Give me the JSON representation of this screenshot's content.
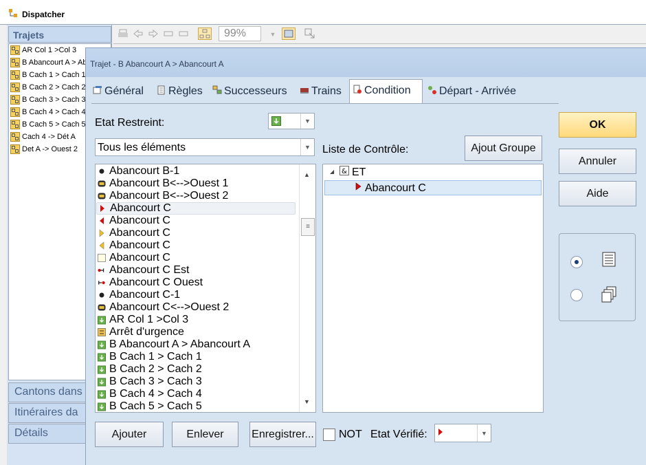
{
  "app": {
    "title": "Dispatcher"
  },
  "left_panel": {
    "header": "Trajets",
    "items": [
      "AR Col 1 >Col 3",
      "B Abancourt A > Abancourt A",
      "B Cach 1 > Cach 1",
      "B Cach 2 > Cach 2",
      "B Cach 3 > Cach 3",
      "B Cach 4 > Cach 4",
      "B Cach 5 > Cach 5",
      "Cach 4 -> Dét A",
      "Det A -> Ouest 2"
    ],
    "nav": [
      "Cantons dans",
      "Itinéraires da",
      "Détails"
    ]
  },
  "toolbar": {
    "zoom": "99%"
  },
  "dialog": {
    "title": "Trajet - B Abancourt A > Abancourt A",
    "tabs": [
      "Général",
      "Règles",
      "Successeurs",
      "Trains",
      "Condition",
      "Départ - Arrivée"
    ],
    "selected_tab": "Condition",
    "etat_restreint_label": "Etat Restreint:",
    "filter_value": "Tous les éléments",
    "liste_label": "Liste de Contrôle:",
    "ajout_groupe": "Ajout Groupe",
    "elements": [
      {
        "text": "Abancourt B-1",
        "icon": "dot"
      },
      {
        "text": "Abancourt B<-->Ouest 1",
        "icon": "loco"
      },
      {
        "text": "Abancourt B<-->Ouest 2",
        "icon": "loco"
      },
      {
        "text": "Abancourt C",
        "icon": "tri-right-red"
      },
      {
        "text": "Abancourt C",
        "icon": "tri-left-red"
      },
      {
        "text": "Abancourt C",
        "icon": "tri-right-yellow"
      },
      {
        "text": "Abancourt C",
        "icon": "tri-left-yellow"
      },
      {
        "text": "Abancourt C",
        "icon": "empty-box"
      },
      {
        "text": "Abancourt C Est",
        "icon": "signal-left"
      },
      {
        "text": "Abancourt C Ouest",
        "icon": "signal-right"
      },
      {
        "text": "Abancourt C-1",
        "icon": "dot"
      },
      {
        "text": "Abancourt C<-->Ouest 2",
        "icon": "loco"
      },
      {
        "text": "AR Col 1 >Col 3",
        "icon": "green-arrow"
      },
      {
        "text": "Arrêt d'urgence",
        "icon": "emergency"
      },
      {
        "text": "B Abancourt A > Abancourt A",
        "icon": "green-arrow"
      },
      {
        "text": "B Cach 1 > Cach 1",
        "icon": "green-arrow"
      },
      {
        "text": "B Cach 2 > Cach 2",
        "icon": "green-arrow"
      },
      {
        "text": "B Cach 3 > Cach 3",
        "icon": "green-arrow"
      },
      {
        "text": "B Cach 4 > Cach 4",
        "icon": "green-arrow"
      },
      {
        "text": "B Cach 5 > Cach 5",
        "icon": "green-arrow"
      }
    ],
    "control_tree": {
      "root": "ET",
      "child": "Abancourt C"
    },
    "buttons": {
      "ok": "OK",
      "cancel": "Annuler",
      "help": "Aide",
      "add": "Ajouter",
      "remove": "Enlever",
      "save": "Enregistrer...",
      "not": "NOT",
      "etat_verifie": "Etat Vérifié:"
    }
  }
}
